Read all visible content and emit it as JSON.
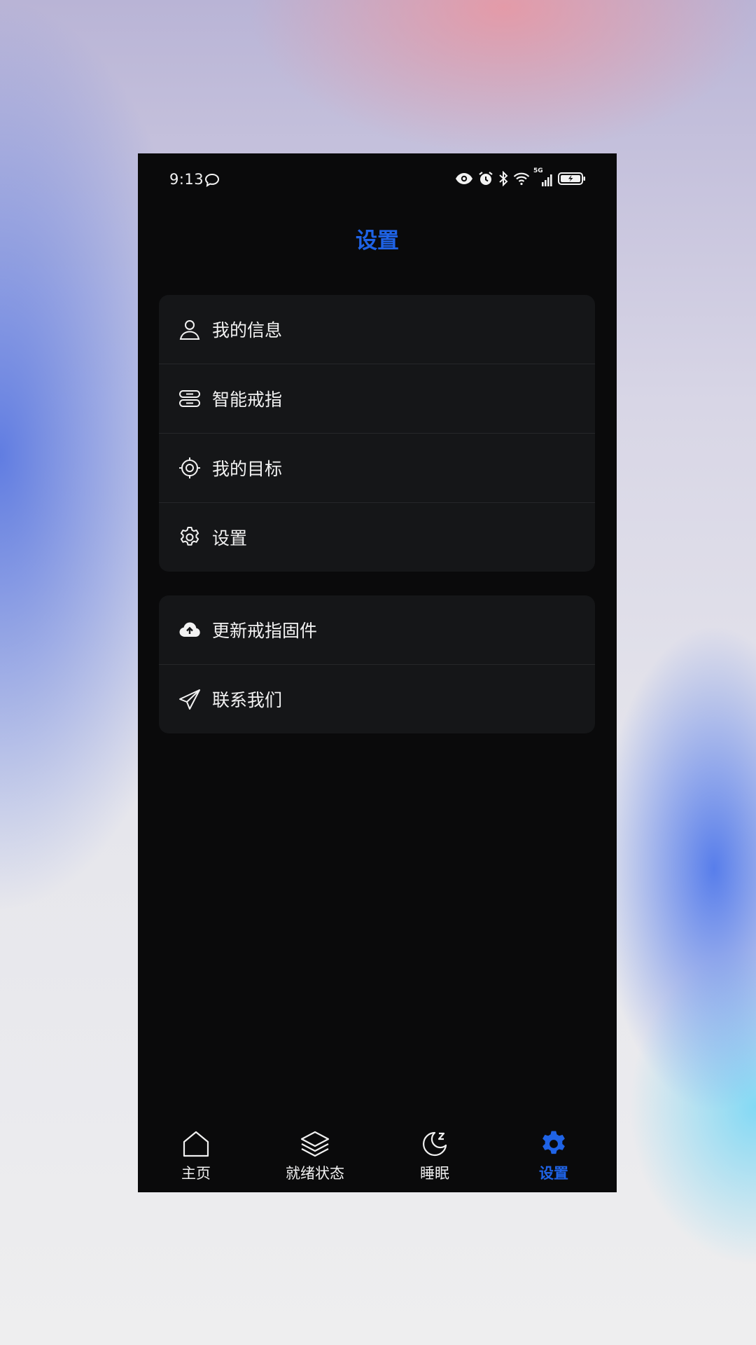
{
  "status_bar": {
    "time": "9:13",
    "network": "5G",
    "icons": [
      "chat-bubble-icon",
      "eye-icon",
      "alarm-icon",
      "bluetooth-icon",
      "wifi-icon",
      "signal-icon",
      "battery-icon"
    ]
  },
  "header": {
    "title": "设置"
  },
  "menu_group_1": [
    {
      "label": "我的信息",
      "icon": "user-icon"
    },
    {
      "label": "智能戒指",
      "icon": "ring-device-icon"
    },
    {
      "label": "我的目标",
      "icon": "target-icon"
    },
    {
      "label": "设置",
      "icon": "gear-icon"
    }
  ],
  "menu_group_2": [
    {
      "label": "更新戒指固件",
      "icon": "cloud-upload-icon"
    },
    {
      "label": "联系我们",
      "icon": "paper-plane-icon"
    }
  ],
  "tabbar": {
    "active": 3,
    "items": [
      {
        "label": "主页",
        "icon": "home-icon"
      },
      {
        "label": "就绪状态",
        "icon": "layers-icon"
      },
      {
        "label": "睡眠",
        "icon": "moon-sleep-icon"
      },
      {
        "label": "设置",
        "icon": "gear-icon"
      }
    ]
  },
  "colors": {
    "accent": "#1f63e6",
    "background": "#0a0a0b",
    "card": "#151618",
    "text": "#f2f2f2"
  }
}
